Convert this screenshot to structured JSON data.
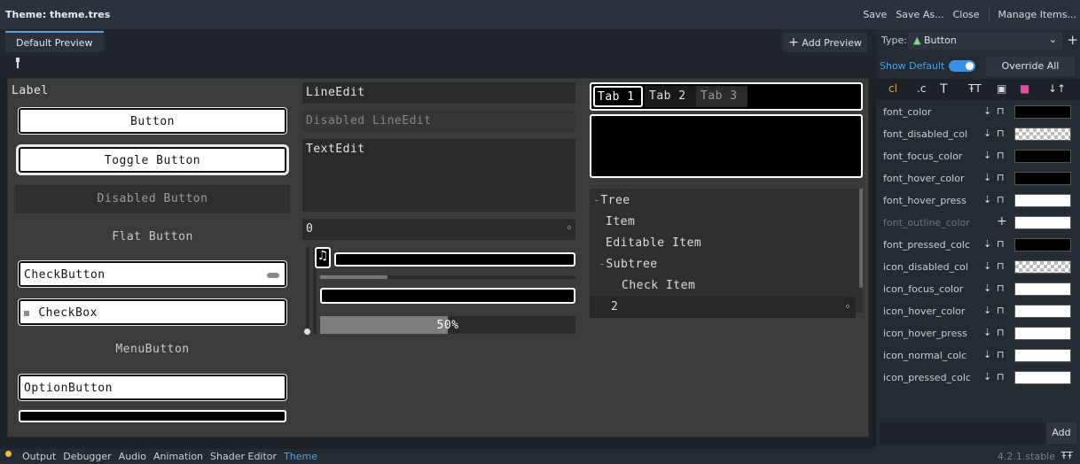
{
  "top_bar": {
    "title": "Theme: theme.tres",
    "save": "Save",
    "save_as": "Save As...",
    "close": "Close",
    "manage_items": "Manage Items..."
  },
  "preview_tabs": {
    "default_tab": "Default Preview",
    "add_preview": "Add Preview"
  },
  "preview": {
    "label": "Label",
    "button": "Button",
    "toggle_button": "Toggle Button",
    "disabled_button": "Disabled Button",
    "flat_button": "Flat Button",
    "check_button": "CheckButton",
    "check_box": "CheckBox",
    "menu_button": "MenuButton",
    "option_button": "OptionButton",
    "line_edit": "LineEdit",
    "disabled_line_edit": "Disabled LineEdit",
    "text_edit": "TextEdit",
    "spinbox_value": "0",
    "progress_text": "50%",
    "progress_value": 0.5,
    "tabs": [
      "Tab 1",
      "Tab 2",
      "Tab 3"
    ],
    "tree": [
      {
        "text": "Tree",
        "depth": 0
      },
      {
        "text": "Item",
        "depth": 1
      },
      {
        "text": "Editable Item",
        "depth": 1
      },
      {
        "text": "Subtree",
        "depth": 1
      },
      {
        "text": "Check Item",
        "depth": 2
      },
      {
        "text": "2",
        "depth": 1
      }
    ]
  },
  "dock": {
    "type_label": "Type:",
    "type_value": "Button",
    "show_default": "Show Default",
    "show_default_on": true,
    "override_all": "Override All",
    "add_label": "Add",
    "properties": [
      {
        "name": "font_color",
        "color": "#000000",
        "dim": false
      },
      {
        "name": "font_disabled_col",
        "color": "checker",
        "dim": false
      },
      {
        "name": "font_focus_color",
        "color": "#000000",
        "dim": false
      },
      {
        "name": "font_hover_color",
        "color": "#000000",
        "dim": false
      },
      {
        "name": "font_hover_press",
        "color": "#ffffff",
        "dim": false
      },
      {
        "name": "font_outline_color",
        "color": "#ffffff",
        "dim": true
      },
      {
        "name": "font_pressed_colc",
        "color": "#000000",
        "dim": false
      },
      {
        "name": "icon_disabled_col",
        "color": "checker",
        "dim": false
      },
      {
        "name": "icon_focus_color",
        "color": "#ffffff",
        "dim": false
      },
      {
        "name": "icon_hover_color",
        "color": "#ffffff",
        "dim": false
      },
      {
        "name": "icon_hover_press",
        "color": "#ffffff",
        "dim": false
      },
      {
        "name": "icon_normal_colc",
        "color": "#ffffff",
        "dim": false
      },
      {
        "name": "icon_pressed_colc",
        "color": "#ffffff",
        "dim": false
      }
    ]
  },
  "bottom_bar": {
    "items": [
      "Output",
      "Debugger",
      "Audio",
      "Animation",
      "Shader Editor",
      "Theme"
    ],
    "active": "Theme",
    "version": "4.2.1.stable"
  },
  "colors": {
    "accent": "#4da0ee",
    "editor_bg": "#1d2229",
    "preview_bg": "#3b3b3b"
  }
}
